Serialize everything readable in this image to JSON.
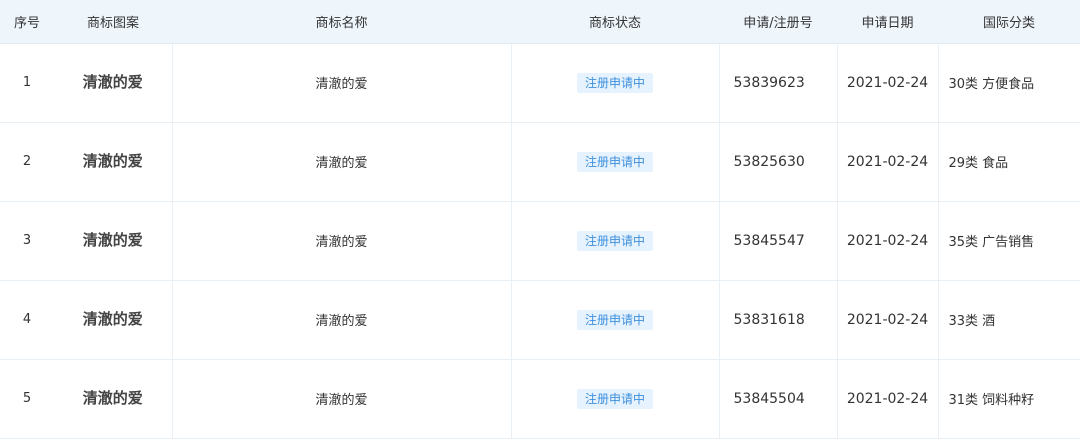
{
  "table": {
    "headers": {
      "index": "序号",
      "pattern": "商标图案",
      "name": "商标名称",
      "status": "商标状态",
      "reg_no": "申请/注册号",
      "date": "申请日期",
      "class": "国际分类"
    },
    "rows": [
      {
        "index": "1",
        "pattern": "清澈的爱",
        "name": "清澈的爱",
        "status": "注册申请中",
        "reg_no": "53839623",
        "date": "2021-02-24",
        "class": "30类 方便食品"
      },
      {
        "index": "2",
        "pattern": "清澈的爱",
        "name": "清澈的爱",
        "status": "注册申请中",
        "reg_no": "53825630",
        "date": "2021-02-24",
        "class": "29类 食品"
      },
      {
        "index": "3",
        "pattern": "清澈的爱",
        "name": "清澈的爱",
        "status": "注册申请中",
        "reg_no": "53845547",
        "date": "2021-02-24",
        "class": "35类 广告销售"
      },
      {
        "index": "4",
        "pattern": "清澈的爱",
        "name": "清澈的爱",
        "status": "注册申请中",
        "reg_no": "53831618",
        "date": "2021-02-24",
        "class": "33类 酒"
      },
      {
        "index": "5",
        "pattern": "清澈的爱",
        "name": "清澈的爱",
        "status": "注册申请中",
        "reg_no": "53845504",
        "date": "2021-02-24",
        "class": "31类 饲料种籽"
      }
    ]
  },
  "colors": {
    "header_bg": "#eef6fc",
    "badge_bg": "#e6f3ff",
    "badge_text": "#3d8fdd",
    "border": "#e8f0f6"
  }
}
